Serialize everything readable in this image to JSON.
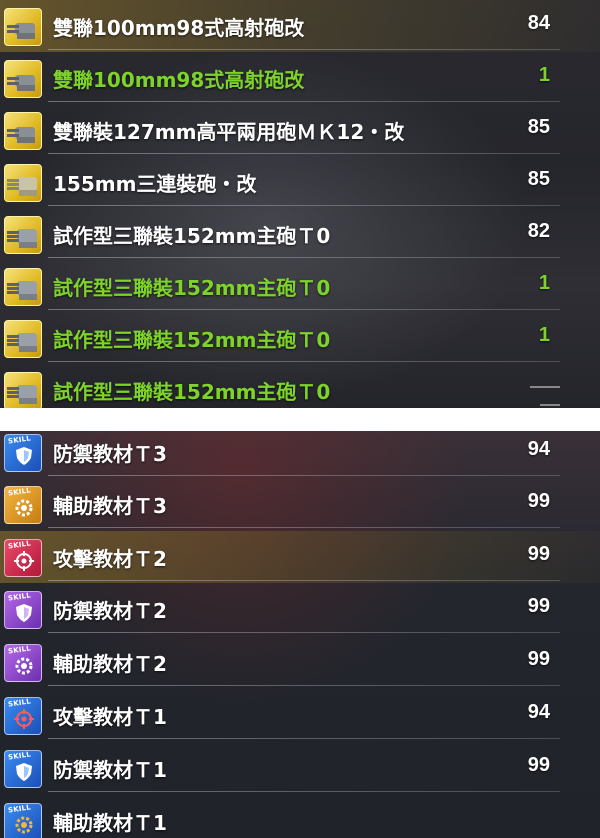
{
  "equipment": [
    {
      "name": "雙聯100mm98式高射砲改",
      "count": "84",
      "highlight": false,
      "selected": true
    },
    {
      "name": "雙聯100mm98式高射砲改",
      "count": "1",
      "highlight": true,
      "selected": false
    },
    {
      "name": "雙聯裝127mm高平兩用砲ＭＫ12・改",
      "count": "85",
      "highlight": false,
      "selected": false
    },
    {
      "name": "155mm三連裝砲・改",
      "count": "85",
      "highlight": false,
      "selected": false
    },
    {
      "name": "試作型三聯裝152mm主砲Ｔ0",
      "count": "82",
      "highlight": false,
      "selected": false
    },
    {
      "name": "試作型三聯裝152mm主砲Ｔ0",
      "count": "1",
      "highlight": true,
      "selected": false
    },
    {
      "name": "試作型三聯裝152mm主砲Ｔ0",
      "count": "1",
      "highlight": true,
      "selected": false
    },
    {
      "name": "試作型三聯裝152mm主砲Ｔ0",
      "count": "",
      "highlight": true,
      "selected": false
    }
  ],
  "skill_books": [
    {
      "name": "防禦教材Ｔ3",
      "count": "94",
      "icon": "shield-icon",
      "color": "blue",
      "selected": false
    },
    {
      "name": "輔助教材Ｔ3",
      "count": "99",
      "icon": "gear-icon",
      "color": "gold",
      "selected": false
    },
    {
      "name": "攻擊教材Ｔ2",
      "count": "99",
      "icon": "crosshair-icon",
      "color": "red",
      "selected": true
    },
    {
      "name": "防禦教材Ｔ2",
      "count": "99",
      "icon": "shield-icon",
      "color": "purple",
      "selected": false
    },
    {
      "name": "輔助教材Ｔ2",
      "count": "99",
      "icon": "gear-icon",
      "color": "purple",
      "selected": false
    },
    {
      "name": "攻擊教材Ｔ1",
      "count": "94",
      "icon": "crosshair-icon",
      "color": "blue",
      "selected": false
    },
    {
      "name": "防禦教材Ｔ1",
      "count": "99",
      "icon": "shield-icon",
      "color": "blue",
      "selected": false
    },
    {
      "name": "輔助教材Ｔ1",
      "count": "",
      "icon": "gear-icon",
      "color": "blue",
      "selected": false
    }
  ],
  "skill_tag": "SKILL",
  "colors": {
    "highlight_green": "#7ed32a",
    "selected_gold": "#9a7a28",
    "text": "#ffffff"
  }
}
